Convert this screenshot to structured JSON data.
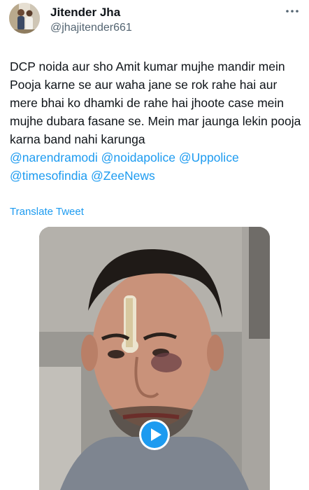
{
  "user": {
    "display_name": "Jitender Jha",
    "handle": "@jhajitender661"
  },
  "tweet": {
    "text": "DCP noida aur sho Amit kumar mujhe mandir mein Pooja karne se aur waha jane se rok rahe hai aur mere bhai ko dhamki de rahe hai jhoote case mein mujhe dubara fasane se. Mein mar jaunga lekin pooja karna band nahi karunga",
    "mentions": [
      "@narendramodi",
      "@noidapolice",
      "@Uppolice",
      "@timesofindia",
      "@ZeeNews"
    ],
    "translate_label": "Translate Tweet"
  },
  "icons": {
    "more": "more-horizontal-icon",
    "play": "play-icon"
  },
  "colors": {
    "accent": "#1d9bf0",
    "secondary_text": "#536471",
    "primary_text": "#0f1419"
  }
}
